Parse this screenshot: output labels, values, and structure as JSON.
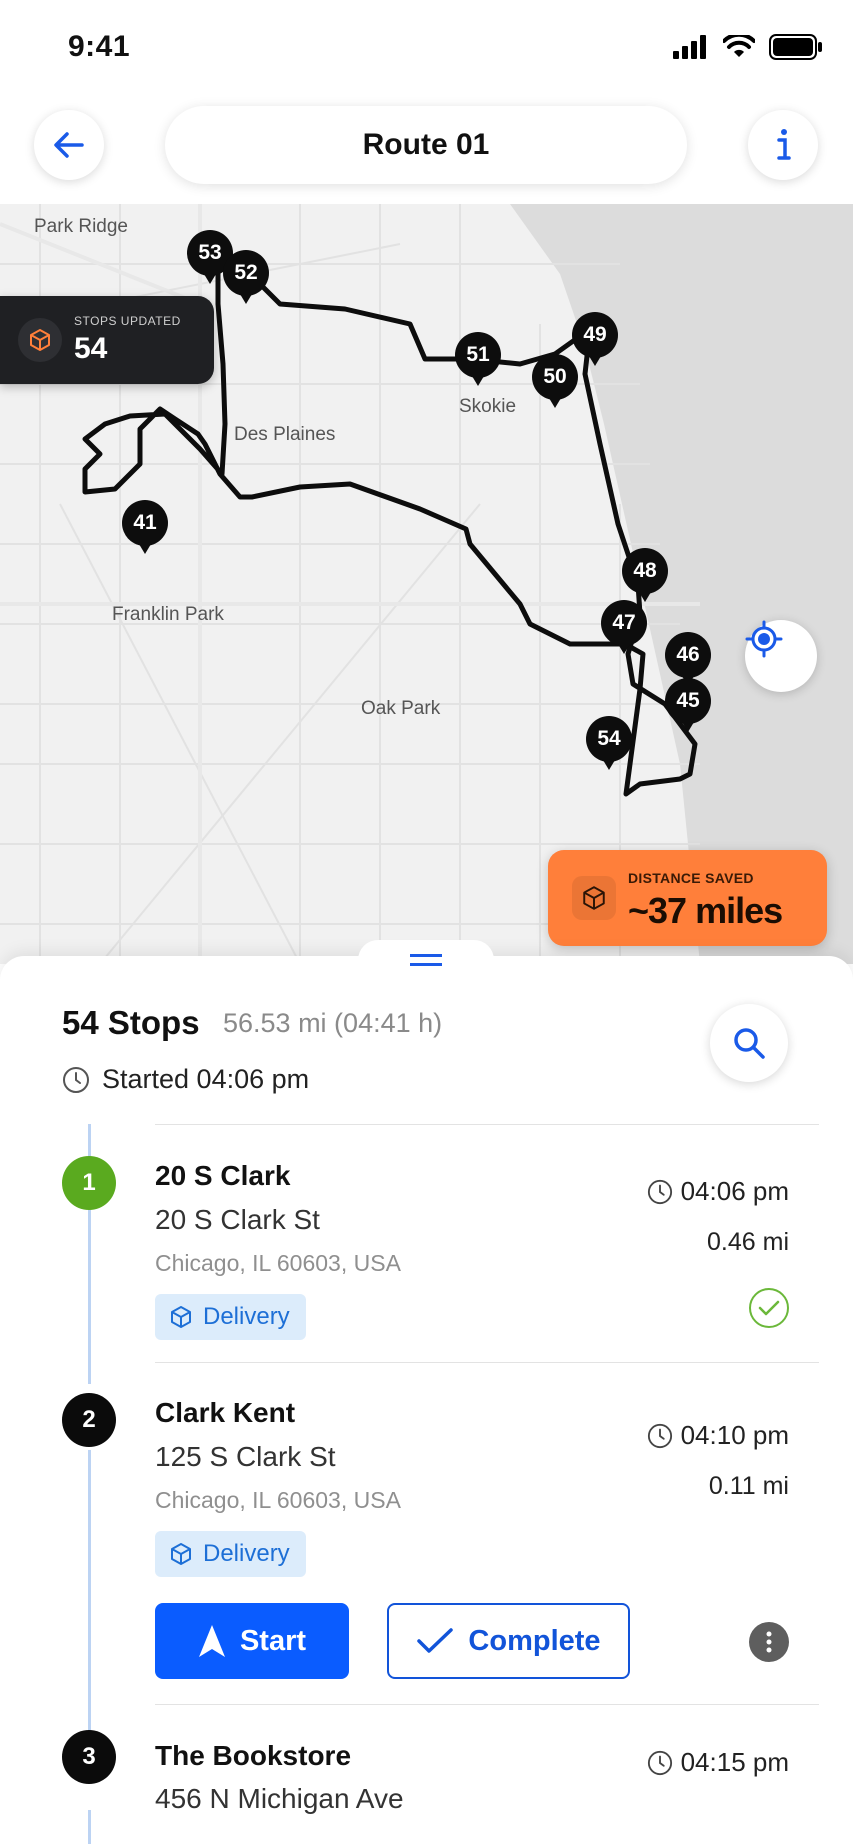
{
  "status_bar": {
    "time": "9:41"
  },
  "header": {
    "title": "Route 01"
  },
  "map": {
    "labels": {
      "park_ridge": "Park Ridge",
      "des_plaines": "Des Plaines",
      "skokie": "Skokie",
      "franklin_park": "Franklin Park",
      "oak_park": "Oak Park"
    },
    "pins": {
      "p53": "53",
      "p52": "52",
      "p51": "51",
      "p50": "50",
      "p49": "49",
      "p41": "41",
      "p48": "48",
      "p47": "47",
      "p46": "46",
      "p45": "45",
      "p54": "54"
    },
    "stops_updated": {
      "label": "STOPS UPDATED",
      "value": "54"
    },
    "distance_saved": {
      "label": "DISTANCE SAVED",
      "value": "~37 miles"
    }
  },
  "summary": {
    "stops": "54 Stops",
    "distance_time": "56.53 mi (04:41 h)",
    "started": "Started 04:06 pm"
  },
  "stops": [
    {
      "number": "1",
      "name": "20 S Clark",
      "address": "20 S Clark St",
      "city": "Chicago, IL 60603, USA",
      "tag": "Delivery",
      "time": "04:06 pm",
      "distance": "0.46 mi",
      "status": "completed"
    },
    {
      "number": "2",
      "name": "Clark Kent",
      "address": "125 S Clark St",
      "city": "Chicago, IL 60603, USA",
      "tag": "Delivery",
      "time": "04:10 pm",
      "distance": "0.11 mi",
      "status": "pending"
    },
    {
      "number": "3",
      "name": "The Bookstore",
      "address": "456 N Michigan Ave",
      "time": "04:15 pm"
    }
  ],
  "actions": {
    "start": "Start",
    "complete": "Complete"
  },
  "colors": {
    "accent": "#0a5cff",
    "orange": "#ff7f3a",
    "done_green": "#5aaa1f"
  }
}
